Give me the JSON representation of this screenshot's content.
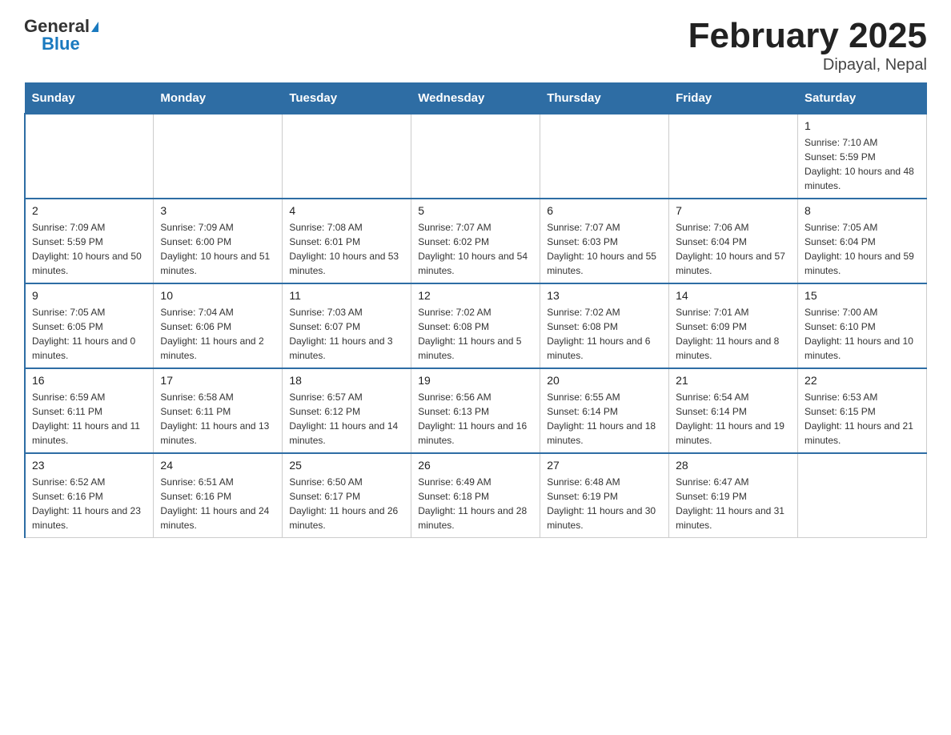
{
  "header": {
    "logo_general": "General",
    "logo_blue": "Blue",
    "title": "February 2025",
    "subtitle": "Dipayal, Nepal"
  },
  "calendar": {
    "days_of_week": [
      "Sunday",
      "Monday",
      "Tuesday",
      "Wednesday",
      "Thursday",
      "Friday",
      "Saturday"
    ],
    "weeks": [
      [
        {
          "day": "",
          "info": ""
        },
        {
          "day": "",
          "info": ""
        },
        {
          "day": "",
          "info": ""
        },
        {
          "day": "",
          "info": ""
        },
        {
          "day": "",
          "info": ""
        },
        {
          "day": "",
          "info": ""
        },
        {
          "day": "1",
          "info": "Sunrise: 7:10 AM\nSunset: 5:59 PM\nDaylight: 10 hours and 48 minutes."
        }
      ],
      [
        {
          "day": "2",
          "info": "Sunrise: 7:09 AM\nSunset: 5:59 PM\nDaylight: 10 hours and 50 minutes."
        },
        {
          "day": "3",
          "info": "Sunrise: 7:09 AM\nSunset: 6:00 PM\nDaylight: 10 hours and 51 minutes."
        },
        {
          "day": "4",
          "info": "Sunrise: 7:08 AM\nSunset: 6:01 PM\nDaylight: 10 hours and 53 minutes."
        },
        {
          "day": "5",
          "info": "Sunrise: 7:07 AM\nSunset: 6:02 PM\nDaylight: 10 hours and 54 minutes."
        },
        {
          "day": "6",
          "info": "Sunrise: 7:07 AM\nSunset: 6:03 PM\nDaylight: 10 hours and 55 minutes."
        },
        {
          "day": "7",
          "info": "Sunrise: 7:06 AM\nSunset: 6:04 PM\nDaylight: 10 hours and 57 minutes."
        },
        {
          "day": "8",
          "info": "Sunrise: 7:05 AM\nSunset: 6:04 PM\nDaylight: 10 hours and 59 minutes."
        }
      ],
      [
        {
          "day": "9",
          "info": "Sunrise: 7:05 AM\nSunset: 6:05 PM\nDaylight: 11 hours and 0 minutes."
        },
        {
          "day": "10",
          "info": "Sunrise: 7:04 AM\nSunset: 6:06 PM\nDaylight: 11 hours and 2 minutes."
        },
        {
          "day": "11",
          "info": "Sunrise: 7:03 AM\nSunset: 6:07 PM\nDaylight: 11 hours and 3 minutes."
        },
        {
          "day": "12",
          "info": "Sunrise: 7:02 AM\nSunset: 6:08 PM\nDaylight: 11 hours and 5 minutes."
        },
        {
          "day": "13",
          "info": "Sunrise: 7:02 AM\nSunset: 6:08 PM\nDaylight: 11 hours and 6 minutes."
        },
        {
          "day": "14",
          "info": "Sunrise: 7:01 AM\nSunset: 6:09 PM\nDaylight: 11 hours and 8 minutes."
        },
        {
          "day": "15",
          "info": "Sunrise: 7:00 AM\nSunset: 6:10 PM\nDaylight: 11 hours and 10 minutes."
        }
      ],
      [
        {
          "day": "16",
          "info": "Sunrise: 6:59 AM\nSunset: 6:11 PM\nDaylight: 11 hours and 11 minutes."
        },
        {
          "day": "17",
          "info": "Sunrise: 6:58 AM\nSunset: 6:11 PM\nDaylight: 11 hours and 13 minutes."
        },
        {
          "day": "18",
          "info": "Sunrise: 6:57 AM\nSunset: 6:12 PM\nDaylight: 11 hours and 14 minutes."
        },
        {
          "day": "19",
          "info": "Sunrise: 6:56 AM\nSunset: 6:13 PM\nDaylight: 11 hours and 16 minutes."
        },
        {
          "day": "20",
          "info": "Sunrise: 6:55 AM\nSunset: 6:14 PM\nDaylight: 11 hours and 18 minutes."
        },
        {
          "day": "21",
          "info": "Sunrise: 6:54 AM\nSunset: 6:14 PM\nDaylight: 11 hours and 19 minutes."
        },
        {
          "day": "22",
          "info": "Sunrise: 6:53 AM\nSunset: 6:15 PM\nDaylight: 11 hours and 21 minutes."
        }
      ],
      [
        {
          "day": "23",
          "info": "Sunrise: 6:52 AM\nSunset: 6:16 PM\nDaylight: 11 hours and 23 minutes."
        },
        {
          "day": "24",
          "info": "Sunrise: 6:51 AM\nSunset: 6:16 PM\nDaylight: 11 hours and 24 minutes."
        },
        {
          "day": "25",
          "info": "Sunrise: 6:50 AM\nSunset: 6:17 PM\nDaylight: 11 hours and 26 minutes."
        },
        {
          "day": "26",
          "info": "Sunrise: 6:49 AM\nSunset: 6:18 PM\nDaylight: 11 hours and 28 minutes."
        },
        {
          "day": "27",
          "info": "Sunrise: 6:48 AM\nSunset: 6:19 PM\nDaylight: 11 hours and 30 minutes."
        },
        {
          "day": "28",
          "info": "Sunrise: 6:47 AM\nSunset: 6:19 PM\nDaylight: 11 hours and 31 minutes."
        },
        {
          "day": "",
          "info": ""
        }
      ]
    ]
  }
}
